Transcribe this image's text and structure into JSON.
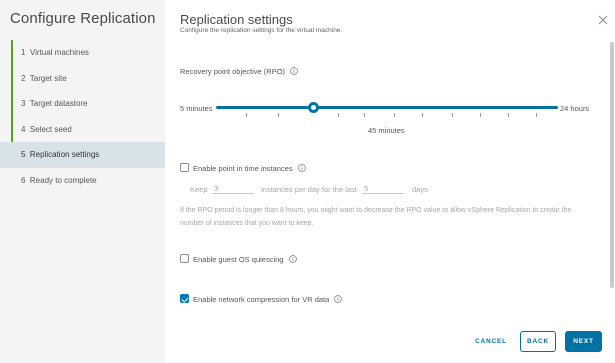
{
  "wizard": {
    "title": "Configure Replication",
    "steps": [
      {
        "number": "1",
        "label": "Virtual machines",
        "status": "done"
      },
      {
        "number": "2",
        "label": "Target site",
        "status": "done"
      },
      {
        "number": "3",
        "label": "Target datastore",
        "status": "done"
      },
      {
        "number": "4",
        "label": "Select seed",
        "status": "done"
      },
      {
        "number": "5",
        "label": "Replication settings",
        "status": "active"
      },
      {
        "number": "6",
        "label": "Ready to complete",
        "status": "pending"
      }
    ]
  },
  "page": {
    "title": "Replication settings",
    "subtitle": "Configure the replication settings for the virtual machine.",
    "close_icon": "close-icon"
  },
  "rpo": {
    "label": "Recovery point objective (RPO)",
    "min_label": "5 minutes",
    "max_label": "24 hours",
    "value_label": "45 minutes",
    "value_fraction": 0.285
  },
  "pit": {
    "label": "Enable point in time instances",
    "checked": false,
    "keep_label": "Keep",
    "keep_value": "3",
    "per_day_label": "instances per day for the last",
    "days_value": "5",
    "days_label": "days",
    "help": "If the RPO period is longer than 8 hours, you might want to decrease the RPO value to allow vSphere Replication to create the number of instances that you want to keep."
  },
  "quiescing": {
    "label": "Enable guest OS quiescing",
    "checked": false
  },
  "compression": {
    "label": "Enable network compression for VR data",
    "checked": true
  },
  "footer": {
    "cancel": "CANCEL",
    "back": "BACK",
    "next": "NEXT"
  },
  "colors": {
    "accent": "#0072a3",
    "step_done": "#5aa220",
    "step_active_bg": "#d8e3e9"
  }
}
